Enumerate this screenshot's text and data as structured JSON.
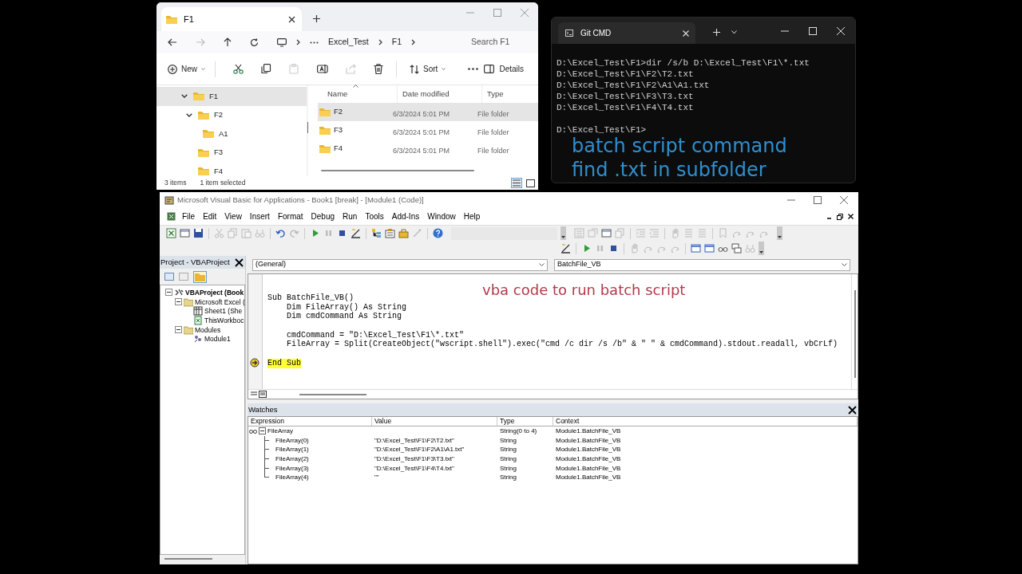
{
  "explorer": {
    "tab_title": "F1",
    "breadcrumbs": [
      "Excel_Test",
      "F1"
    ],
    "search": {
      "placeholder": "Search F1"
    },
    "toolbar": {
      "new": "New",
      "sort": "Sort",
      "details": "Details"
    },
    "tree": [
      {
        "label": "F1",
        "selected": true,
        "expanded": true,
        "children": [
          {
            "label": "F2",
            "selected": false,
            "expanded": true,
            "children": [
              {
                "label": "A1",
                "selected": false,
                "expanded": false
              }
            ]
          },
          {
            "label": "F3",
            "selected": false,
            "expanded": false
          },
          {
            "label": "F4",
            "selected": false,
            "expanded": false
          }
        ]
      }
    ],
    "columns": [
      "Name",
      "Date modified",
      "Type"
    ],
    "rows": [
      {
        "name": "F2",
        "date": "6/3/2024 5:01 PM",
        "type": "File folder",
        "selected": true
      },
      {
        "name": "F3",
        "date": "6/3/2024 5:01 PM",
        "type": "File folder",
        "selected": false
      },
      {
        "name": "F4",
        "date": "6/3/2024 5:01 PM",
        "type": "File folder",
        "selected": false
      }
    ],
    "status": {
      "count": "3 items",
      "selection": "1 item selected"
    }
  },
  "terminal": {
    "title": "Git CMD",
    "blocks": [
      [
        "D:\\Excel_Test\\F1>dir /s/b D:\\Excel_Test\\F1\\*.txt",
        "D:\\Excel_Test\\F1\\F2\\T2.txt",
        "D:\\Excel_Test\\F1\\F2\\A1\\A1.txt",
        "D:\\Excel_Test\\F1\\F3\\T3.txt",
        "D:\\Excel_Test\\F1\\F4\\T4.txt"
      ],
      [
        "D:\\Excel_Test\\F1>"
      ]
    ],
    "caption": [
      "batch script command",
      "find .txt in subfolder"
    ]
  },
  "vba": {
    "title": "Microsoft Visual Basic for Applications - Book1 [break] - [Module1 (Code)]",
    "menu": [
      "File",
      "Edit",
      "View",
      "Insert",
      "Format",
      "Debug",
      "Run",
      "Tools",
      "Add-Ins",
      "Window",
      "Help"
    ],
    "project": {
      "title": "Project - VBAProject",
      "tree": [
        {
          "label": "VBAProject (Book",
          "kind": "project",
          "expanded": true,
          "children": [
            {
              "label": "Microsoft Excel (",
              "kind": "folder",
              "expanded": true,
              "children": [
                {
                  "label": "Sheet1 (She",
                  "kind": "sheet"
                },
                {
                  "label": "ThisWorkboc",
                  "kind": "workbook"
                }
              ]
            },
            {
              "label": "Modules",
              "kind": "folder",
              "expanded": true,
              "children": [
                {
                  "label": "Module1",
                  "kind": "module"
                }
              ]
            }
          ]
        }
      ]
    },
    "object_dropdown": "(General)",
    "procedure_dropdown": "BatchFile_VB",
    "caption": "vba code to run batch script",
    "code": [
      {
        "text": "Sub BatchFile_VB()",
        "blank_before": false,
        "current": false
      },
      {
        "text": "    Dim FileArray() As String",
        "blank_before": false,
        "current": false
      },
      {
        "text": "    Dim cmdCommand As String",
        "blank_before": false,
        "current": false
      },
      {
        "text": "    cmdCommand = \"D:\\Excel_Test\\F1\\*.txt\"",
        "blank_before": true,
        "current": false
      },
      {
        "text": "    FileArray = Split(CreateObject(\"wscript.shell\").exec(\"cmd /c dir /s /b\" & \" \" & cmdCommand).stdout.readall, vbCrLf)",
        "blank_before": false,
        "current": false
      },
      {
        "text": "End Sub",
        "blank_before": true,
        "current": true
      }
    ],
    "watches": {
      "title": "Watches",
      "columns": [
        "Expression",
        "Value",
        "Type",
        "Context"
      ],
      "rows": [
        {
          "expression": "FileArray",
          "type": "String(0 to 4)",
          "context": "Module1.BatchFile_VB",
          "expanded": true,
          "children": [
            {
              "expression": "FileArray(0)",
              "value": "\"D:\\Excel_Test\\F1\\F2\\T2.txt\"",
              "type": "String",
              "context": "Module1.BatchFile_VB"
            },
            {
              "expression": "FileArray(1)",
              "value": "\"D:\\Excel_Test\\F1\\F2\\A1\\A1.txt\"",
              "type": "String",
              "context": "Module1.BatchFile_VB"
            },
            {
              "expression": "FileArray(2)",
              "value": "\"D:\\Excel_Test\\F1\\F3\\T3.txt\"",
              "type": "String",
              "context": "Module1.BatchFile_VB"
            },
            {
              "expression": "FileArray(3)",
              "value": "\"D:\\Excel_Test\\F1\\F4\\T4.txt\"",
              "type": "String",
              "context": "Module1.BatchFile_VB"
            },
            {
              "expression": "FileArray(4)",
              "value": "\"\"",
              "type": "String",
              "context": "Module1.BatchFile_VB"
            }
          ]
        }
      ]
    }
  }
}
